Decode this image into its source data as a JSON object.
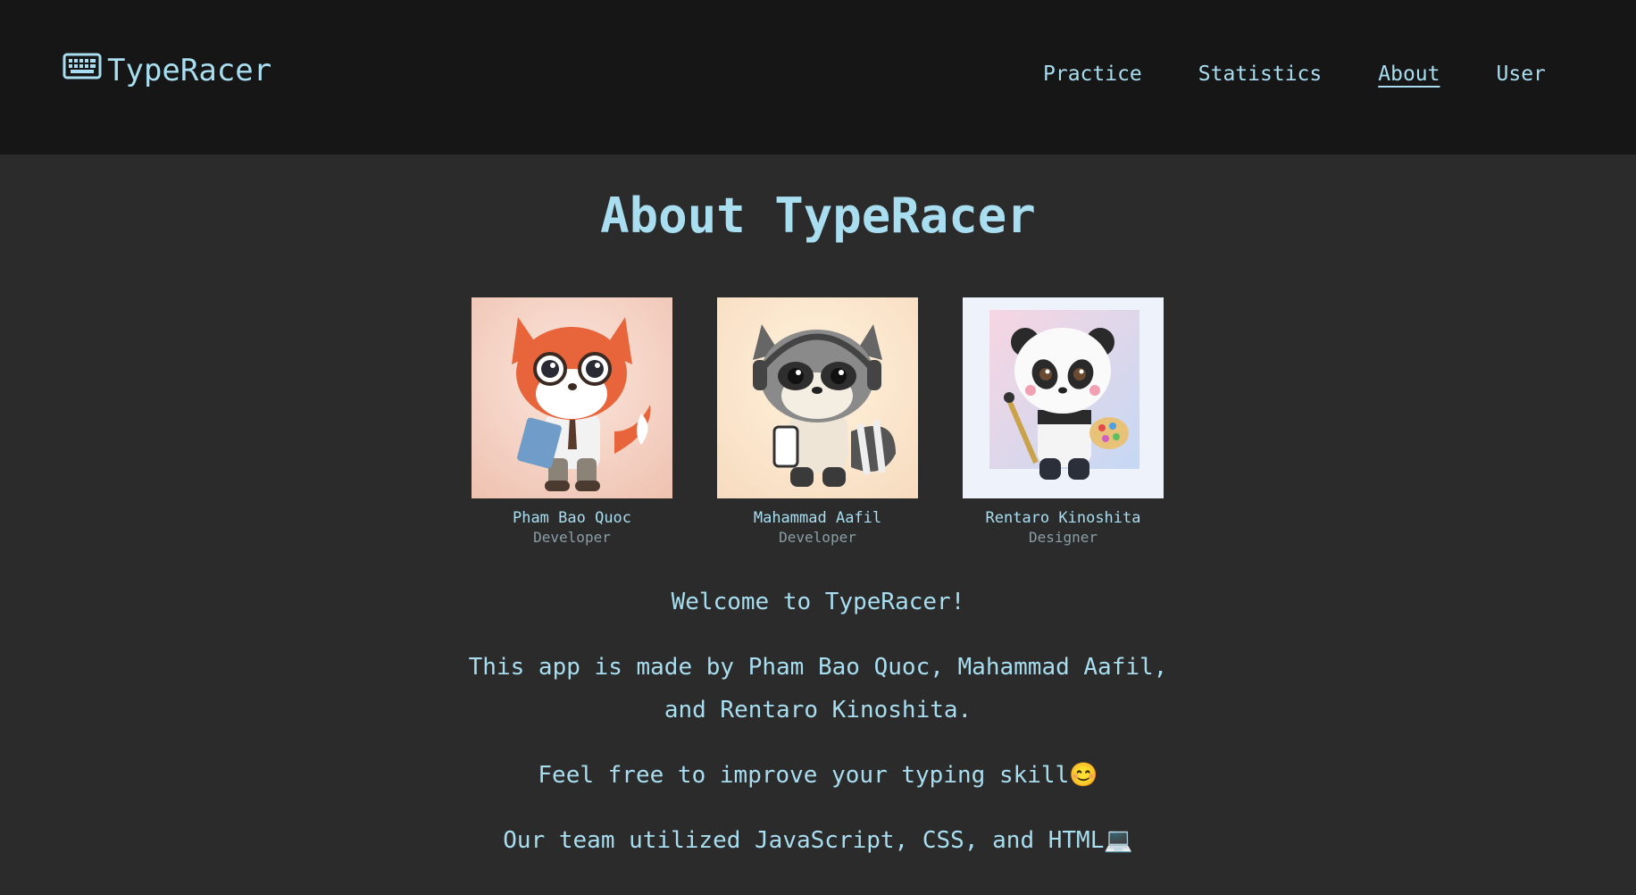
{
  "header": {
    "brand": "TypeRacer",
    "brand_icon": "keyboard-icon",
    "nav": [
      {
        "label": "Practice",
        "active": false
      },
      {
        "label": "Statistics",
        "active": false
      },
      {
        "label": "About",
        "active": true
      },
      {
        "label": "User",
        "active": false
      }
    ]
  },
  "main": {
    "title": "About TypeRacer",
    "team": [
      {
        "name": "Pham Bao Quoc",
        "role": "Developer",
        "avatar": "fox-avatar"
      },
      {
        "name": "Mahammad Aafil",
        "role": "Developer",
        "avatar": "raccoon-avatar"
      },
      {
        "name": "Rentaro Kinoshita",
        "role": "Designer",
        "avatar": "panda-avatar"
      }
    ],
    "paragraphs": [
      "Welcome to TypeRacer!",
      "This app is made by Pham Bao Quoc, Mahammad Aafil, and Rentaro Kinoshita.",
      "Feel free to improve your typing skill😊",
      "Our team utilized JavaScript, CSS, and HTML💻"
    ]
  },
  "colors": {
    "accent": "#a8def0",
    "header_bg": "#161616",
    "page_bg": "#2b2b2b",
    "role_text": "#8a9ea6"
  }
}
